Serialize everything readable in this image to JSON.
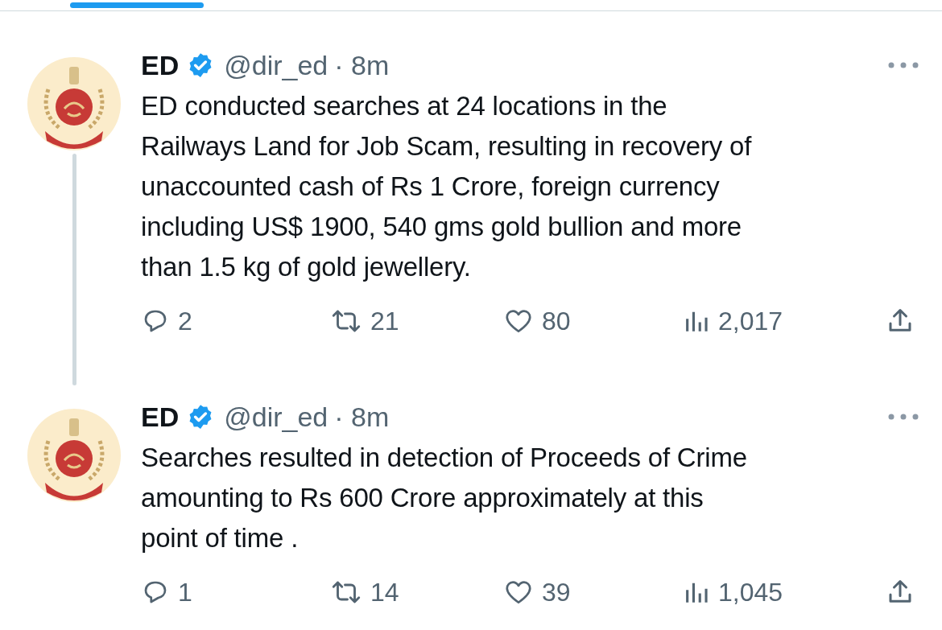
{
  "tab_indicator": {
    "selected": true
  },
  "tweets": [
    {
      "author": "ED",
      "verified": true,
      "handle": "@dir_ed",
      "time": "· 8m",
      "thread_line": true,
      "text": "ED conducted searches at 24 locations in the\nRailways Land for Job Scam, resulting in recovery of\nunaccounted cash of Rs 1 Crore, foreign currency\nincluding US$ 1900, 540 gms gold bullion and more\nthan 1.5 kg of gold jewellery.",
      "replies": "2",
      "reposts": "21",
      "likes": "80",
      "views": "2,017"
    },
    {
      "author": "ED",
      "verified": true,
      "handle": "@dir_ed",
      "time": "· 8m",
      "thread_line": false,
      "text": "Searches resulted in detection of Proceeds of Crime\namounting to Rs 600 Crore approximately at this\npoint of time .",
      "replies": "1",
      "reposts": "14",
      "likes": "39",
      "views": "1,045"
    }
  ]
}
